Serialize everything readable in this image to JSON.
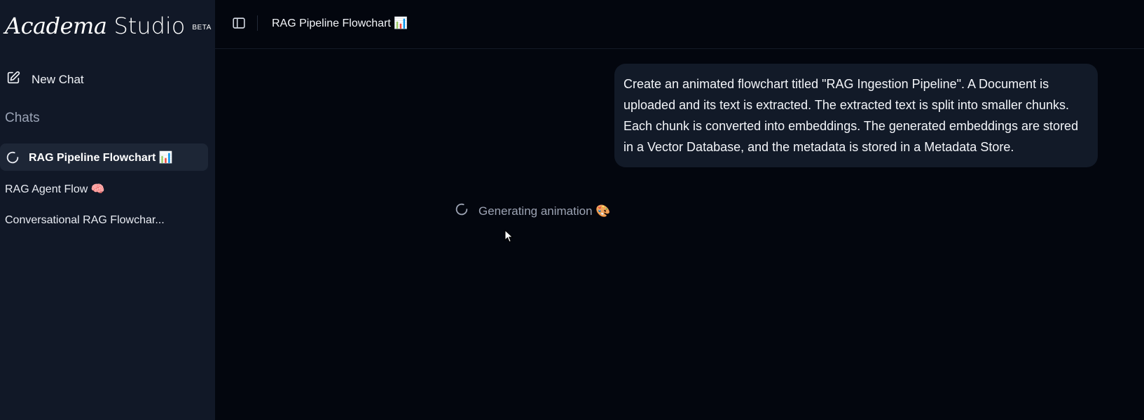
{
  "brand": {
    "script": "Academa",
    "name": "Studio",
    "badge": "BETA"
  },
  "sidebar": {
    "new_chat_label": "New Chat",
    "chats_heading": "Chats",
    "chats": [
      {
        "label": "RAG Pipeline Flowchart 📊",
        "active": true
      },
      {
        "label": "RAG Agent Flow 🧠",
        "active": false
      },
      {
        "label": "Conversational RAG Flowchar...",
        "active": false
      }
    ]
  },
  "header": {
    "title": "RAG Pipeline Flowchart 📊"
  },
  "conversation": {
    "user_message": "Create an animated flowchart titled \"RAG Ingestion Pipeline\". A Document is uploaded and its text is extracted. The extracted text is split into smaller chunks. Each chunk is converted into embeddings. The generated embeddings are stored in a Vector Database, and the metadata is stored in a Metadata Store.",
    "status_text": "Generating animation 🎨"
  },
  "colors": {
    "sidebar_bg": "#111827",
    "main_bg": "#03060e",
    "bubble_bg": "#121a28",
    "active_item_bg": "#1d2636",
    "muted_text": "#9ca3b3"
  },
  "icons": {
    "new_chat": "edit-square-icon",
    "sidebar_toggle": "sidebar-panel-icon",
    "loading": "spinner-icon",
    "cursor": "mouse-pointer-icon"
  }
}
